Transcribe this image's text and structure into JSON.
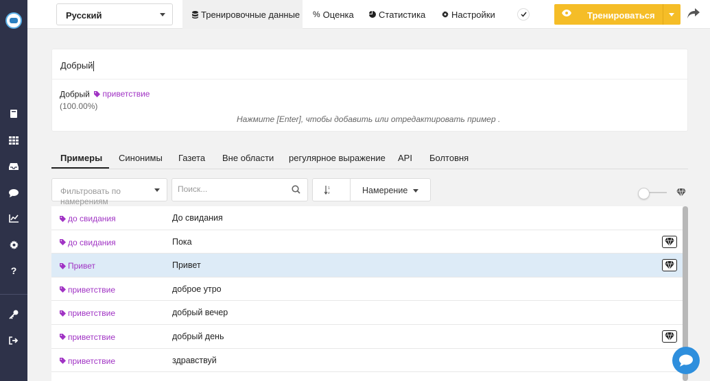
{
  "header": {
    "language": "Русский",
    "tabs": [
      {
        "label": "Тренировочные данные",
        "icon": "database-icon"
      },
      {
        "label": "Оценка",
        "icon": "percent-icon"
      },
      {
        "label": "Статистика",
        "icon": "pie-chart-icon"
      },
      {
        "label": "Настройки",
        "icon": "gear-icon"
      }
    ],
    "train_label": "Тренироваться"
  },
  "editor": {
    "input_value": "Добрый",
    "parsed_text": "Добрый",
    "parsed_intent": "приветствие",
    "confidence": "(100.00%)",
    "hint": "Нажмите [Enter], чтобы добавить или отредактировать пример ."
  },
  "tabs": [
    "Примеры",
    "Синонимы",
    "Газета",
    "Вне области",
    "регулярное выражение",
    "API",
    "Болтовня"
  ],
  "filters": {
    "intent_filter_placeholder": "Фильтровать по намерениям",
    "search_placeholder": "Поиск...",
    "sort_label": "Намерение"
  },
  "examples": [
    {
      "intent": "до свидания",
      "text": "До свидания",
      "gem": false,
      "selected": false
    },
    {
      "intent": "до свидания",
      "text": "Пока",
      "gem": true,
      "selected": false
    },
    {
      "intent": "Привет",
      "text": "Привет",
      "gem": true,
      "selected": true
    },
    {
      "intent": "приветствие",
      "text": "доброе утро",
      "gem": false,
      "selected": false
    },
    {
      "intent": "приветствие",
      "text": "добрый вечер",
      "gem": false,
      "selected": false
    },
    {
      "intent": "приветствие",
      "text": "добрый день",
      "gem": true,
      "selected": false
    },
    {
      "intent": "приветствие",
      "text": "здравствуй",
      "gem": false,
      "selected": false
    },
    {
      "intent": "",
      "text": "",
      "gem": false,
      "selected": false
    }
  ],
  "colors": {
    "accent": "#f5bd27",
    "intent": "#a033c4",
    "sidebar": "#2e3249",
    "selected_row": "#ddebf7"
  }
}
